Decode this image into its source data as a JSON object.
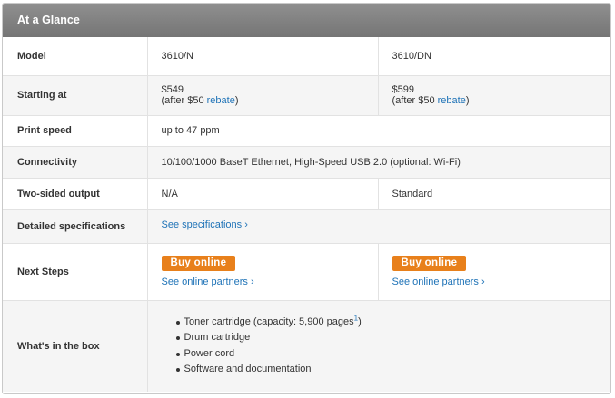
{
  "header": {
    "title": "At a Glance"
  },
  "rows": {
    "model": {
      "label": "Model",
      "a": "3610/N",
      "b": "3610/DN"
    },
    "starting": {
      "label": "Starting at",
      "a_price": "$549",
      "a_note_pre": "(after $50 ",
      "a_link": "rebate",
      "a_note_post": ")",
      "b_price": "$599",
      "b_note_pre": "(after $50 ",
      "b_link": "rebate",
      "b_note_post": ")"
    },
    "speed": {
      "label": "Print speed",
      "value": "up to 47 ppm"
    },
    "connectivity": {
      "label": "Connectivity",
      "value": "10/100/1000 BaseT Ethernet, High-Speed USB 2.0 (optional: Wi-Fi)"
    },
    "twosided": {
      "label": "Two-sided output",
      "a": "N/A",
      "b": "Standard"
    },
    "specs": {
      "label": "Detailed specifications",
      "link": "See specifications ›"
    },
    "next": {
      "label": "Next Steps",
      "button": "Buy online",
      "partners": "See online partners ›"
    },
    "box": {
      "label": "What's in the box",
      "items": [
        "Toner cartridge (capacity: 5,900 pages",
        "Drum cartridge",
        "Power cord",
        "Software and documentation"
      ],
      "footnote": "1",
      "footnote_close": ")"
    }
  }
}
